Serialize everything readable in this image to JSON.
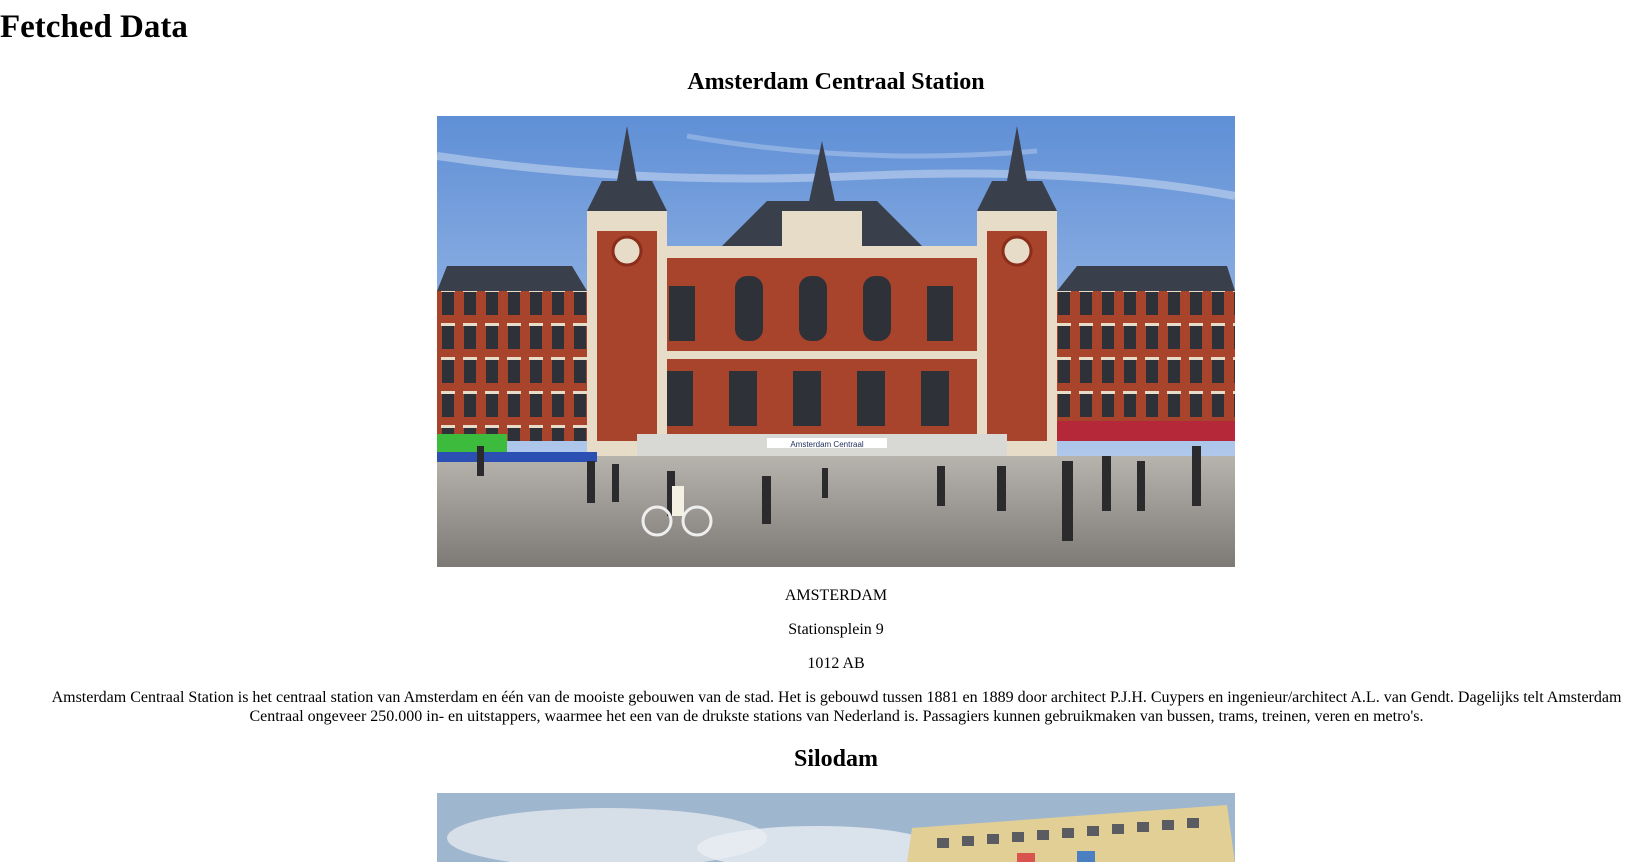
{
  "page": {
    "title": "Fetched Data"
  },
  "entries": [
    {
      "title": "Amsterdam Centraal Station",
      "city": "AMSTERDAM",
      "street": "Stationsplein 9",
      "zip": "1012 AB",
      "description": "Amsterdam Centraal Station is het centraal station van Amsterdam en één van de mooiste gebouwen van de stad. Het is gebouwd tussen 1881 en 1889 door architect P.J.H. Cuypers en ingenieur/architect A.L. van Gendt. Dagelijks telt Amsterdam Centraal ongeveer 250.000 in- en uitstappers, waarmee het een van de drukste stations van Nederland is. Passagiers kunnen gebruikmaken van bussen, trams, treinen, veren en metro's.",
      "photo_sign": "Amsterdam Centraal"
    },
    {
      "title": "Silodam"
    }
  ],
  "colors": {
    "sky": "#8fb3e3",
    "brick": "#a8432c",
    "stone": "#e7dcc8",
    "roof": "#3a3f4c",
    "pavement": "#9a9a9a"
  }
}
